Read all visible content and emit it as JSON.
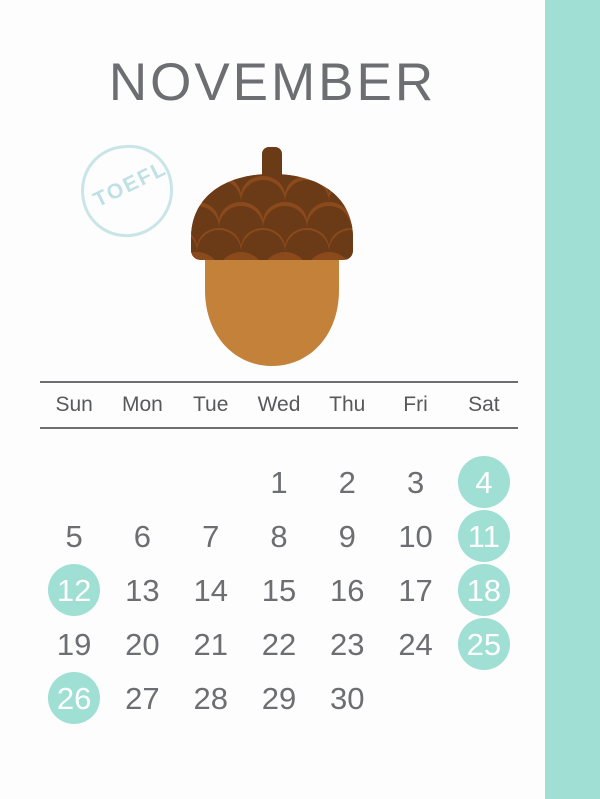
{
  "page": {
    "title": "NOVEMBER",
    "background_color": "#fdfdfd",
    "accent_color": "#9fdfd4"
  },
  "stamp": {
    "label": "TOEFL",
    "color": "#bfe0e4"
  },
  "illustration": {
    "name": "acorn",
    "cap_base_color": "#8a4a1c",
    "cap_scale_color": "#6b3a17",
    "nut_color": "#c48139",
    "stem_color": "#6b3a17"
  },
  "calendar": {
    "month": "NOVEMBER",
    "weekdays": [
      "Sun",
      "Mon",
      "Tue",
      "Wed",
      "Thu",
      "Fri",
      "Sat"
    ],
    "leading_blanks": 3,
    "days": [
      {
        "n": "1",
        "weekday": "Wed",
        "highlight": false
      },
      {
        "n": "2",
        "weekday": "Thu",
        "highlight": false
      },
      {
        "n": "3",
        "weekday": "Fri",
        "highlight": false
      },
      {
        "n": "4",
        "weekday": "Sat",
        "highlight": true
      },
      {
        "n": "5",
        "weekday": "Sun",
        "highlight": false
      },
      {
        "n": "6",
        "weekday": "Mon",
        "highlight": false
      },
      {
        "n": "7",
        "weekday": "Tue",
        "highlight": false
      },
      {
        "n": "8",
        "weekday": "Wed",
        "highlight": false
      },
      {
        "n": "9",
        "weekday": "Thu",
        "highlight": false
      },
      {
        "n": "10",
        "weekday": "Fri",
        "highlight": false
      },
      {
        "n": "11",
        "weekday": "Sat",
        "highlight": true
      },
      {
        "n": "12",
        "weekday": "Sun",
        "highlight": true
      },
      {
        "n": "13",
        "weekday": "Mon",
        "highlight": false
      },
      {
        "n": "14",
        "weekday": "Tue",
        "highlight": false
      },
      {
        "n": "15",
        "weekday": "Wed",
        "highlight": false
      },
      {
        "n": "16",
        "weekday": "Thu",
        "highlight": false
      },
      {
        "n": "17",
        "weekday": "Fri",
        "highlight": false
      },
      {
        "n": "18",
        "weekday": "Sat",
        "highlight": true
      },
      {
        "n": "19",
        "weekday": "Sun",
        "highlight": false
      },
      {
        "n": "20",
        "weekday": "Mon",
        "highlight": false
      },
      {
        "n": "21",
        "weekday": "Tue",
        "highlight": false
      },
      {
        "n": "22",
        "weekday": "Wed",
        "highlight": false
      },
      {
        "n": "23",
        "weekday": "Thu",
        "highlight": false
      },
      {
        "n": "24",
        "weekday": "Fri",
        "highlight": false
      },
      {
        "n": "25",
        "weekday": "Sat",
        "highlight": true
      },
      {
        "n": "26",
        "weekday": "Sun",
        "highlight": true
      },
      {
        "n": "27",
        "weekday": "Mon",
        "highlight": false
      },
      {
        "n": "28",
        "weekday": "Tue",
        "highlight": false
      },
      {
        "n": "29",
        "weekday": "Wed",
        "highlight": false
      },
      {
        "n": "30",
        "weekday": "Thu",
        "highlight": false
      }
    ],
    "highlight_color": "#9fdfd4",
    "highlight_text_color": "#ffffff",
    "text_color": "#6d6e71"
  }
}
